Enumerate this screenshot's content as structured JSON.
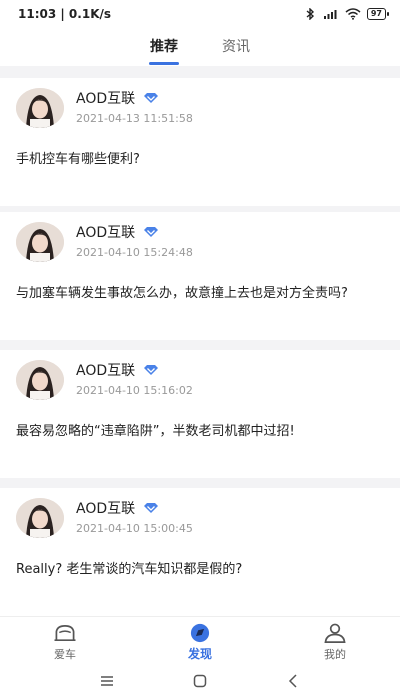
{
  "status_bar": {
    "time_speed": "11:03 | 0.1K/s",
    "battery": "97",
    "icons": [
      "bluetooth-icon",
      "signal-hd-icon",
      "wifi-icon",
      "battery-icon"
    ]
  },
  "tabs": [
    {
      "label": "推荐",
      "active": true
    },
    {
      "label": "资讯",
      "active": false
    }
  ],
  "posts": [
    {
      "author": "AOD互联",
      "time": "2021-04-13 11:51:58",
      "title": "手机控车有哪些便利?"
    },
    {
      "author": "AOD互联",
      "time": "2021-04-10 15:24:48",
      "title": "与加塞车辆发生事故怎么办，故意撞上去也是对方全责吗?"
    },
    {
      "author": "AOD互联",
      "time": "2021-04-10 15:16:02",
      "title": "最容易忽略的“违章陷阱”，半数老司机都中过招!"
    },
    {
      "author": "AOD互联",
      "time": "2021-04-10 15:00:45",
      "title": "Really? 老生常谈的汽车知识都是假的?"
    }
  ],
  "bottom_nav": [
    {
      "label": "爱车",
      "icon": "car-icon",
      "active": false
    },
    {
      "label": "发现",
      "icon": "discover-icon",
      "active": true
    },
    {
      "label": "我的",
      "icon": "user-icon",
      "active": false
    }
  ],
  "colors": {
    "accent": "#3a72e0",
    "background": "#f3f3f5",
    "card": "#ffffff",
    "muted": "#999999"
  }
}
